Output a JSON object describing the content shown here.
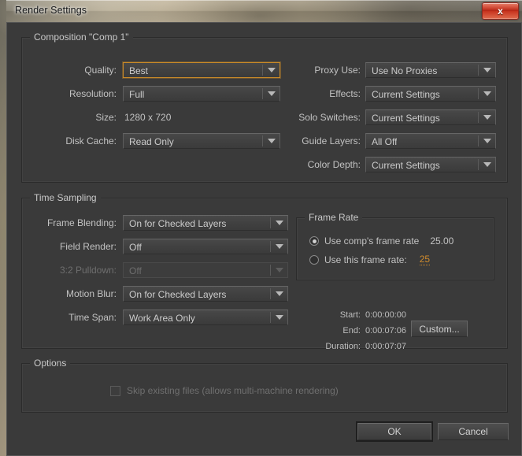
{
  "window": {
    "title": "Render Settings",
    "close_label": "x",
    "accent_focus_color": "#c98a28",
    "link_color": "#d08b2c",
    "background_color": "#3a3a3a"
  },
  "composition": {
    "group_title": "Composition \"Comp 1\"",
    "left_fields": [
      {
        "label": "Quality:",
        "value": "Best",
        "focused": true,
        "disabled": false
      },
      {
        "label": "Resolution:",
        "value": "Full",
        "focused": false,
        "disabled": false
      },
      {
        "label": "Disk Cache:",
        "value": "Read Only",
        "focused": false,
        "disabled": false
      }
    ],
    "size_label": "Size:",
    "size_value": "1280 x 720",
    "right_fields": [
      {
        "label": "Proxy Use:",
        "value": "Use No Proxies",
        "focused": false,
        "disabled": false
      },
      {
        "label": "Effects:",
        "value": "Current Settings",
        "focused": false,
        "disabled": false
      },
      {
        "label": "Solo Switches:",
        "value": "Current Settings",
        "focused": false,
        "disabled": false
      },
      {
        "label": "Guide Layers:",
        "value": "All Off",
        "focused": false,
        "disabled": false
      },
      {
        "label": "Color Depth:",
        "value": "Current Settings",
        "focused": false,
        "disabled": false
      }
    ]
  },
  "time_sampling": {
    "group_title": "Time Sampling",
    "fields": [
      {
        "label": "Frame Blending:",
        "value": "On for Checked Layers",
        "disabled": false
      },
      {
        "label": "Field Render:",
        "value": "Off",
        "disabled": false
      },
      {
        "label": "3:2 Pulldown:",
        "value": "Off",
        "disabled": true
      },
      {
        "label": "Motion Blur:",
        "value": "On for Checked Layers",
        "disabled": false
      },
      {
        "label": "Time Span:",
        "value": "Work Area Only",
        "disabled": false
      }
    ],
    "frame_rate": {
      "group_title": "Frame Rate",
      "option_comp": {
        "label": "Use comp's frame rate",
        "value": "25.00",
        "selected": true
      },
      "option_custom": {
        "label": "Use this frame rate:",
        "value": "25",
        "selected": false
      }
    },
    "timecodes": {
      "start_label": "Start:",
      "start_value": "0:00:00:00",
      "end_label": "End:",
      "end_value": "0:00:07:06",
      "duration_label": "Duration:",
      "duration_value": "0:00:07:07",
      "custom_button": "Custom..."
    }
  },
  "options": {
    "group_title": "Options",
    "skip_existing": {
      "label": "Skip existing files (allows multi-machine rendering)",
      "checked": false,
      "disabled": true
    }
  },
  "footer": {
    "ok_label": "OK",
    "cancel_label": "Cancel"
  }
}
